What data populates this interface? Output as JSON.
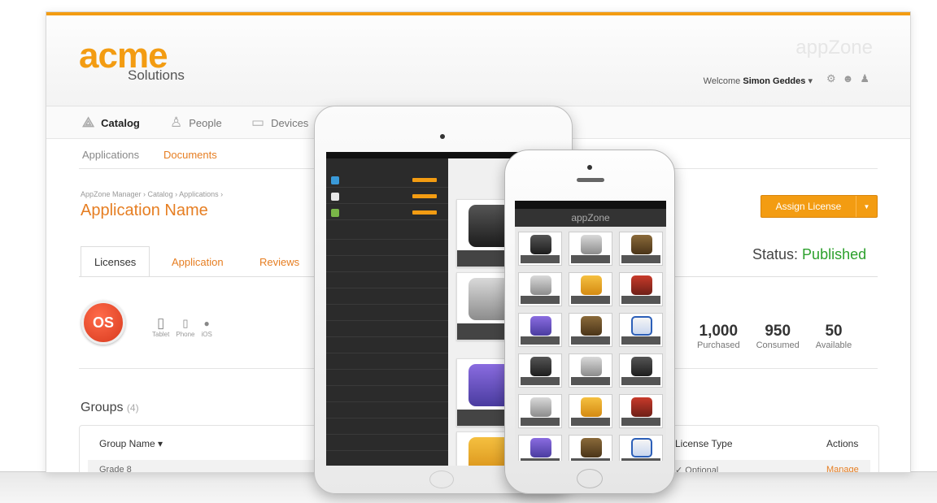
{
  "header": {
    "logo_mark": "acme",
    "logo_sub": "Solutions",
    "brand_faint": "appZone",
    "welcome_prefix": "Welcome",
    "user_name": "Simon Geddes",
    "user_caret": "▾"
  },
  "nav": {
    "items": [
      {
        "label": "Catalog",
        "icon": "catalog-icon"
      },
      {
        "label": "People",
        "icon": "person-icon"
      },
      {
        "label": "Devices",
        "icon": "device-icon"
      }
    ],
    "subnav": [
      "Applications",
      "Documents"
    ]
  },
  "page": {
    "breadcrumb": "AppZone Manager › Catalog › Applications ›",
    "title": "Application Name",
    "assign_button": "Assign License",
    "tabs": [
      "Licenses",
      "Application",
      "Reviews"
    ],
    "status_label": "Status:",
    "status_value": "Published"
  },
  "app": {
    "icon_text": "OS",
    "platforms": [
      {
        "label": "Tablet",
        "glyph": "▯"
      },
      {
        "label": "Phone",
        "glyph": "▯"
      },
      {
        "label": "iOS",
        "glyph": "●"
      }
    ]
  },
  "stats": [
    {
      "value": "1,000",
      "label": "Purchased"
    },
    {
      "value": "950",
      "label": "Consumed"
    },
    {
      "value": "50",
      "label": "Available"
    }
  ],
  "groups": {
    "title": "Groups",
    "count": "(4)",
    "columns": [
      "Group Name ▾",
      "License Type",
      "Actions"
    ],
    "rows": [
      {
        "name": "Grade 8",
        "license_type": "Optional",
        "action": "Manage"
      }
    ]
  },
  "colors": {
    "accent": "#f39c12",
    "link": "#e67e22",
    "status_green": "#2ca02c"
  }
}
